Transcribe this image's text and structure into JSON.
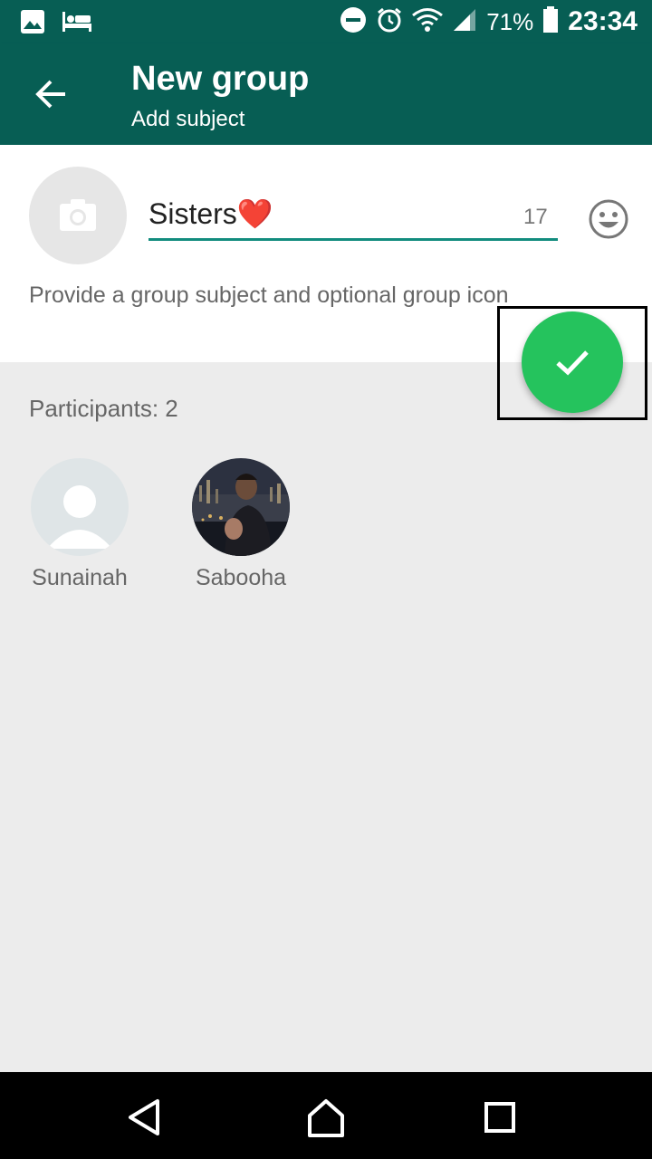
{
  "status_bar": {
    "battery": "71%",
    "time": "23:34",
    "icons": [
      "image-icon",
      "bed-icon",
      "dnd-icon",
      "alarm-icon",
      "wifi-icon",
      "signal-icon",
      "battery-icon"
    ]
  },
  "app_bar": {
    "title": "New group",
    "subtitle": "Add subject",
    "color": "#075e54"
  },
  "form": {
    "subject_value": "Sisters❤️",
    "char_counter": "17",
    "hint": "Provide a group subject and optional group icon",
    "accent_color": "#128c7e"
  },
  "participants": {
    "label": "Participants: 2",
    "items": [
      {
        "name": "Sunainah",
        "avatar": "default-avatar"
      },
      {
        "name": "Sabooha",
        "avatar": "photo-avatar"
      }
    ]
  },
  "fab": {
    "icon": "check-icon",
    "color": "#25c35d"
  },
  "nav_bar": {
    "icons": [
      "nav-back-icon",
      "nav-home-icon",
      "nav-recents-icon"
    ]
  }
}
